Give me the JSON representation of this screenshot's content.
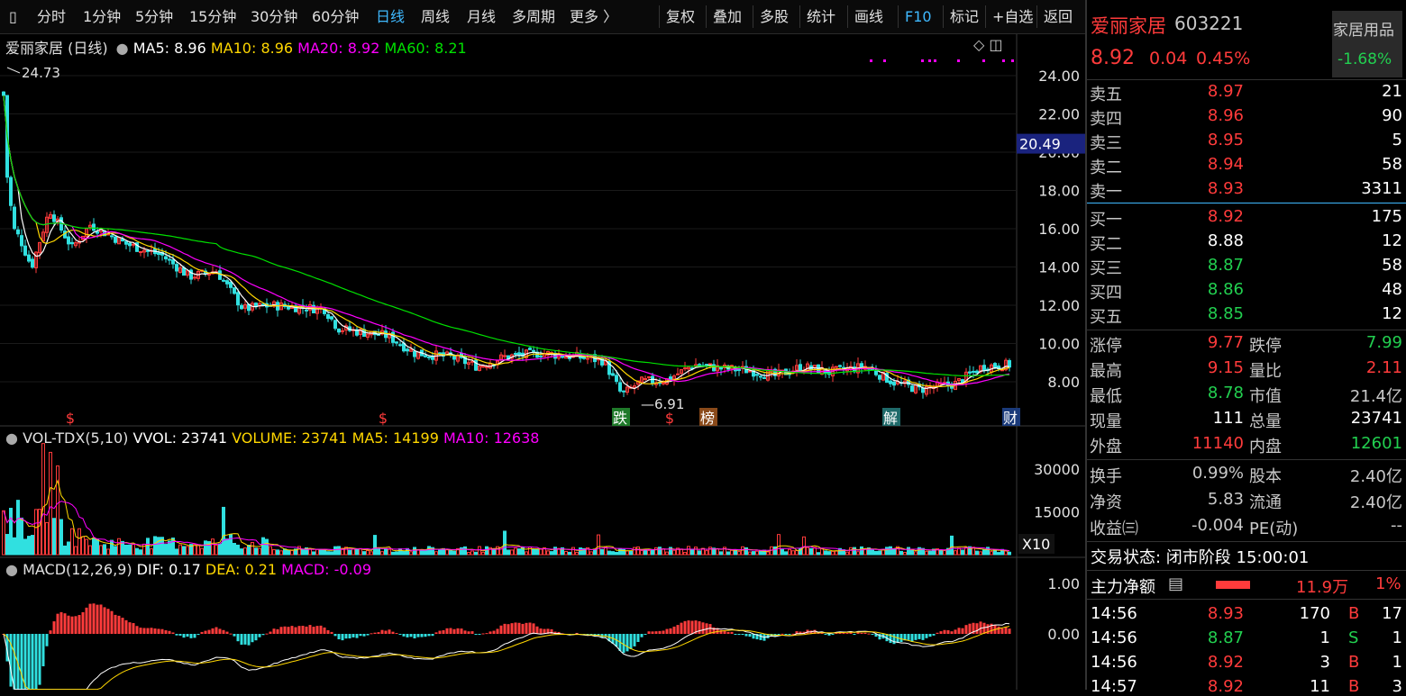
{
  "toolbar": {
    "tabs": [
      "分时",
      "1分钟",
      "5分钟",
      "15分钟",
      "30分钟",
      "60分钟",
      "日线",
      "周线",
      "月线",
      "多周期",
      "更多 〉"
    ],
    "active_tab": "日线",
    "actions": [
      "复权",
      "叠加",
      "多股",
      "统计",
      "画线",
      "F10",
      "标记",
      "+自选",
      "返回"
    ]
  },
  "main_chart": {
    "stock_label": "爱丽家居 (日线)",
    "ma5": "MA5: 8.96",
    "ma10": "MA10: 8.96",
    "ma20": "MA20: 8.92",
    "ma60": "MA60: 8.21",
    "high_marker": "24.73",
    "low_marker": "6.91",
    "cursor_price": "20.49",
    "y_ticks": [
      "24.00",
      "22.00",
      "20.00",
      "18.00",
      "16.00",
      "14.00",
      "12.00",
      "10.00",
      "8.00"
    ],
    "event_marks": [
      "$",
      "$",
      "跌",
      "$",
      "榜",
      "解",
      "财"
    ]
  },
  "volume_chart": {
    "label": "VOL-TDX(5,10)",
    "vvol": "VVOL: 23741",
    "volume": "VOLUME: 23741",
    "ma5": "MA5: 14199",
    "ma10": "MA10: 12638",
    "y_ticks": [
      "30000",
      "15000"
    ],
    "unit": "X10"
  },
  "macd_chart": {
    "label": "MACD(12,26,9)",
    "dif": "DIF: 0.17",
    "dea": "DEA: 0.21",
    "macd": "MACD: -0.09",
    "y_ticks": [
      "1.00",
      "0.00"
    ]
  },
  "colors": {
    "up": "#ff3b3b",
    "down": "#22d050",
    "ma5": "#ffffff",
    "ma10": "#ffd700",
    "ma20": "#ff00ff",
    "ma60": "#00e000",
    "accent": "#3fb9ff"
  },
  "quote": {
    "name": "爱丽家居",
    "code": "603221",
    "sector": "家居用品",
    "sector_change": "-1.68%",
    "price": "8.92",
    "change": "0.04",
    "change_pct": "0.45%",
    "asks": [
      {
        "label": "卖五",
        "price": "8.97",
        "vol": "21",
        "color": "red"
      },
      {
        "label": "卖四",
        "price": "8.96",
        "vol": "90",
        "color": "red"
      },
      {
        "label": "卖三",
        "price": "8.95",
        "vol": "5",
        "color": "red"
      },
      {
        "label": "卖二",
        "price": "8.94",
        "vol": "58",
        "color": "red"
      },
      {
        "label": "卖一",
        "price": "8.93",
        "vol": "3311",
        "color": "red"
      }
    ],
    "bids": [
      {
        "label": "买一",
        "price": "8.92",
        "vol": "175",
        "color": "red"
      },
      {
        "label": "买二",
        "price": "8.88",
        "vol": "12",
        "color": "white"
      },
      {
        "label": "买三",
        "price": "8.87",
        "vol": "58",
        "color": "green"
      },
      {
        "label": "买四",
        "price": "8.86",
        "vol": "48",
        "color": "green"
      },
      {
        "label": "买五",
        "price": "8.85",
        "vol": "12",
        "color": "green"
      }
    ],
    "stats": [
      {
        "l1": "涨停",
        "v1": "9.77",
        "c1": "red",
        "l2": "跌停",
        "v2": "7.99",
        "c2": "green"
      },
      {
        "l1": "最高",
        "v1": "9.15",
        "c1": "red",
        "l2": "量比",
        "v2": "2.11",
        "c2": "red"
      },
      {
        "l1": "最低",
        "v1": "8.78",
        "c1": "green",
        "l2": "市值",
        "v2": "21.4亿",
        "c2": "gray"
      },
      {
        "l1": "现量",
        "v1": "111",
        "c1": "white",
        "l2": "总量",
        "v2": "23741",
        "c2": "white"
      },
      {
        "l1": "外盘",
        "v1": "11140",
        "c1": "red",
        "l2": "内盘",
        "v2": "12601",
        "c2": "green"
      }
    ],
    "fin": [
      {
        "l1": "换手",
        "v1": "0.99%",
        "l2": "股本",
        "v2": "2.40亿"
      },
      {
        "l1": "净资",
        "v1": "5.83",
        "l2": "流通",
        "v2": "2.40亿"
      },
      {
        "l1": "收益㈢",
        "v1": "-0.004",
        "l2": "PE(动)",
        "v2": "--"
      }
    ],
    "trade_status": "交易状态: 闭市阶段 15:00:01",
    "main_force_label": "主力净额",
    "main_force_value": "11.9万",
    "main_force_pct": "1%",
    "ticks": [
      {
        "time": "14:56",
        "price": "8.93",
        "vol": "170",
        "side": "B",
        "count": "17",
        "color": "red"
      },
      {
        "time": "14:56",
        "price": "8.87",
        "vol": "1",
        "side": "S",
        "count": "1",
        "color": "green"
      },
      {
        "time": "14:56",
        "price": "8.92",
        "vol": "3",
        "side": "B",
        "count": "1",
        "color": "red"
      },
      {
        "time": "14:57",
        "price": "8.92",
        "vol": "11",
        "side": "B",
        "count": "3",
        "color": "red"
      }
    ]
  }
}
